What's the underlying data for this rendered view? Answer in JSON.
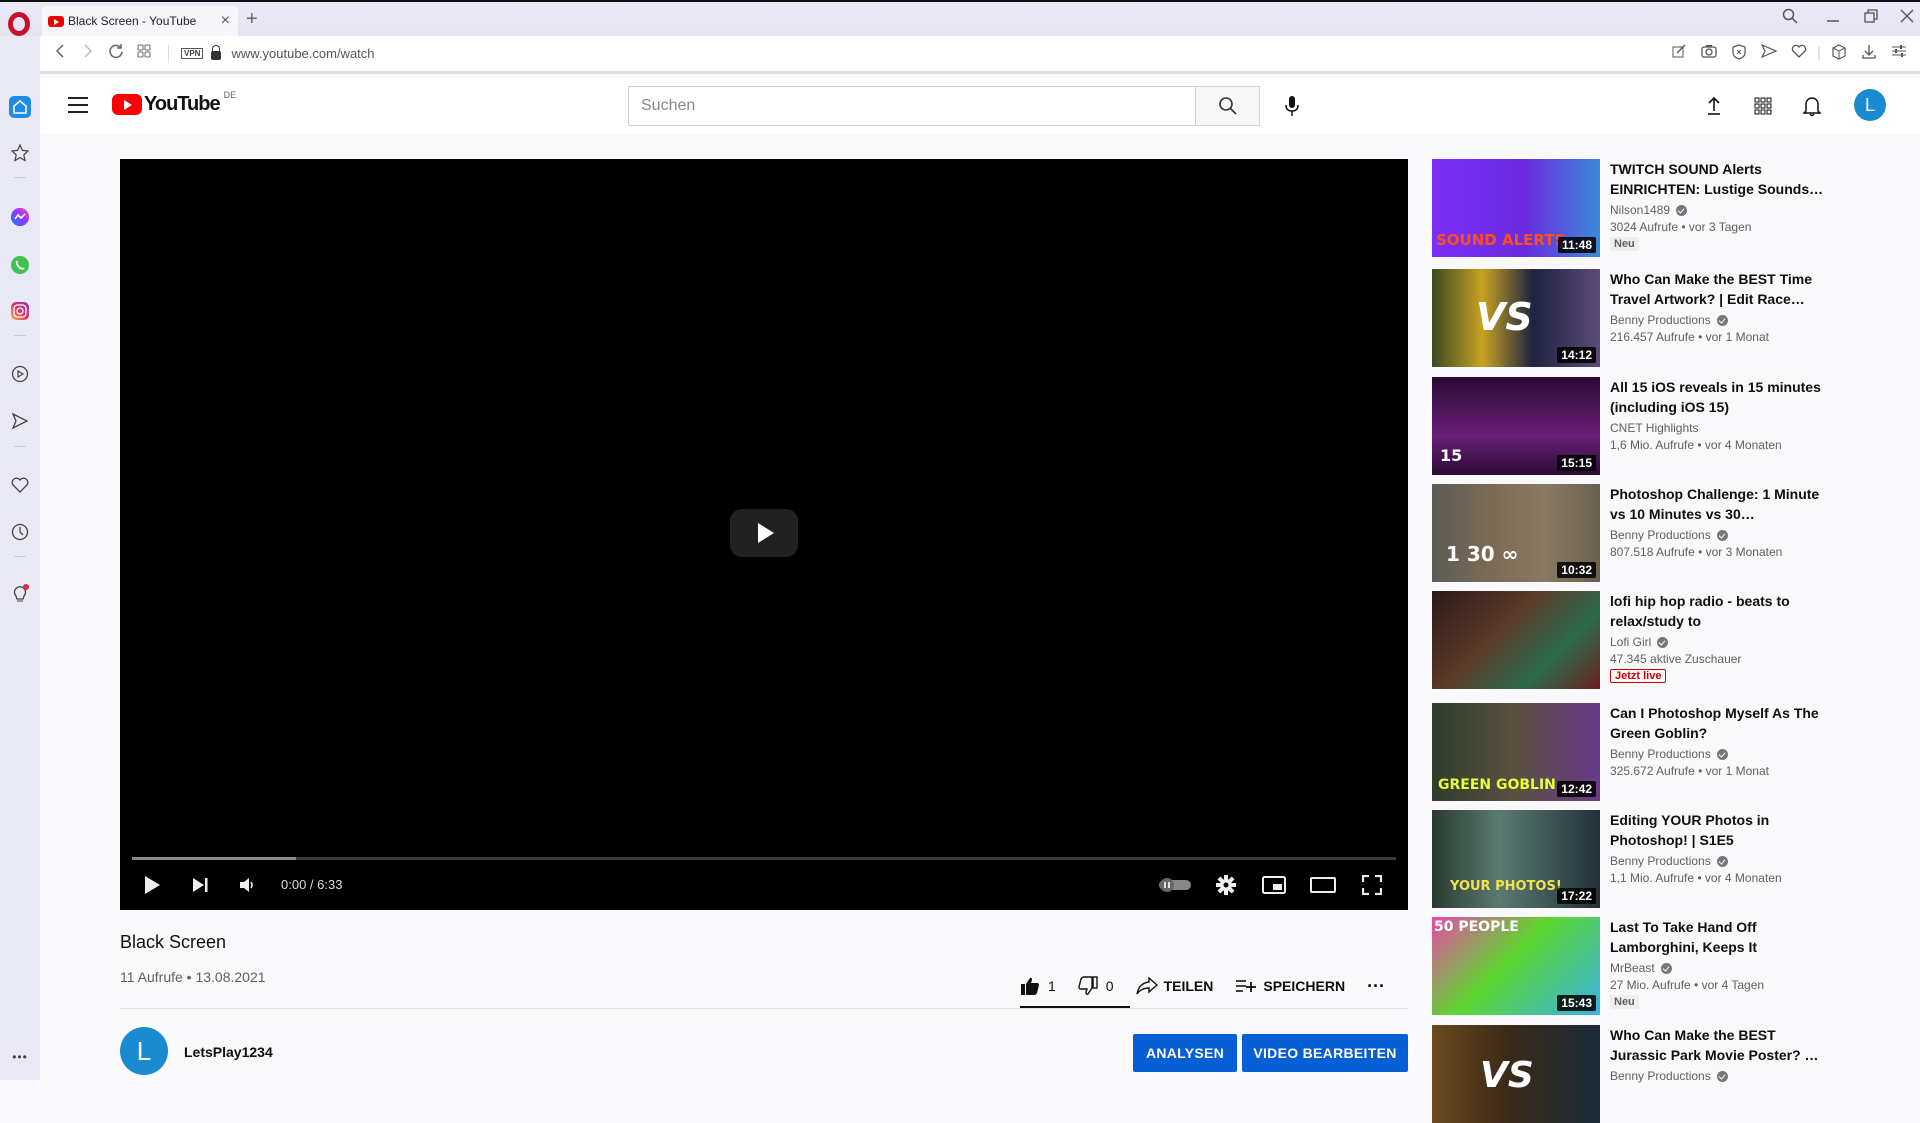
{
  "browser": {
    "tab_title": "Black Screen - YouTube",
    "new_tab_symbol": "+",
    "vpn_label": "VPN",
    "url": "www.youtube.com/watch",
    "toolbar_icons": [
      "snapshot-pin-icon",
      "camera-icon",
      "adblock-icon",
      "send-icon",
      "heart-icon",
      "extensions-cube-icon",
      "download-icon",
      "easy-setup-icon"
    ],
    "window_controls": [
      "search-tabs-icon",
      "minimize-icon",
      "restore-icon",
      "close-icon"
    ]
  },
  "opera_sidebar": {
    "items": [
      {
        "name": "home-icon",
        "active": true
      },
      {
        "name": "bookmarks-star-icon"
      },
      {
        "name": "messenger-icon"
      },
      {
        "name": "whatsapp-icon"
      },
      {
        "name": "instagram-icon"
      },
      {
        "name": "player-icon"
      },
      {
        "name": "my-flow-icon"
      },
      {
        "name": "pinboard-heart-icon"
      },
      {
        "name": "history-icon"
      },
      {
        "name": "tips-bulb-icon"
      }
    ],
    "more_label": "•••"
  },
  "youtube_header": {
    "logo_text": "YouTube",
    "country_code": "DE",
    "search_placeholder": "Suchen",
    "search_value": "",
    "avatar_letter": "L",
    "brand_color": "#ff0000",
    "avatar_color": "#1a8bd0"
  },
  "player": {
    "current_time": "0:00",
    "duration": "6:33",
    "time_display": "0:00 / 6:33",
    "buffered_fraction": 0.13,
    "played_fraction": 0,
    "autoplay_on": false
  },
  "video": {
    "title": "Black Screen",
    "meta": "11 Aufrufe • 13.08.2021",
    "views": "11 Aufrufe",
    "date": "13.08.2021",
    "likes": "1",
    "dislikes": "0",
    "share_label": "TEILEN",
    "save_label": "SPEICHERN",
    "more_label": "···",
    "channel_name": "LetsPlay1234",
    "channel_avatar_letter": "L",
    "analytics_label": "ANALYSEN",
    "edit_label": "VIDEO BEARBEITEN",
    "button_color": "#065fd4"
  },
  "recommendations": [
    {
      "title": "TWITCH SOUND Alerts EINRICHTEN: Lustige Sounds…",
      "channel": "Nilson1489",
      "verified": true,
      "stats": "3024 Aufrufe • vor 3 Tagen",
      "badge": "Neu",
      "badge_type": "new",
      "duration": "11:48",
      "thumb_text": "SOUND ALERTS"
    },
    {
      "title": "Who Can Make the BEST Time Travel Artwork? | Edit Race…",
      "channel": "Benny Productions",
      "verified": true,
      "stats": "216.457 Aufrufe • vor 1 Monat",
      "badge": "",
      "badge_type": "",
      "duration": "14:12",
      "thumb_text": "VS"
    },
    {
      "title": "All 15 iOS reveals in 15 minutes (including iOS 15)",
      "channel": "CNET Highlights",
      "verified": false,
      "stats": "1,6 Mio. Aufrufe • vor 4 Monaten",
      "badge": "",
      "badge_type": "",
      "duration": "15:15",
      "thumb_text": "15"
    },
    {
      "title": "Photoshop Challenge: 1 Minute vs 10 Minutes vs 30…",
      "channel": "Benny Productions",
      "verified": true,
      "stats": "807.518 Aufrufe • vor 3 Monaten",
      "badge": "",
      "badge_type": "",
      "duration": "10:32",
      "thumb_text": "1 30 ∞"
    },
    {
      "title": "lofi hip hop radio - beats to relax/study to",
      "channel": "Lofi Girl",
      "verified": true,
      "stats": "47.345 aktive Zuschauer",
      "badge": "Jetzt live",
      "badge_type": "live",
      "duration": "",
      "thumb_text": ""
    },
    {
      "title": "Can I Photoshop Myself As The Green Goblin?",
      "channel": "Benny Productions",
      "verified": true,
      "stats": "325.672 Aufrufe • vor 1 Monat",
      "badge": "",
      "badge_type": "",
      "duration": "12:42",
      "thumb_text": "GREEN GOBLIN"
    },
    {
      "title": "Editing YOUR Photos in Photoshop! | S1E5",
      "channel": "Benny Productions",
      "verified": true,
      "stats": "1,1 Mio. Aufrufe • vor 4 Monaten",
      "badge": "",
      "badge_type": "",
      "duration": "17:22",
      "thumb_text": "YOUR PHOTOS!"
    },
    {
      "title": "Last To Take Hand Off Lamborghini, Keeps It",
      "channel": "MrBeast",
      "verified": true,
      "stats": "27 Mio. Aufrufe • vor 4 Tagen",
      "badge": "Neu",
      "badge_type": "new",
      "duration": "15:43",
      "thumb_text": "50 PEOPLE"
    },
    {
      "title": "Who Can Make the BEST Jurassic Park Movie Poster? …",
      "channel": "Benny Productions",
      "verified": true,
      "stats": "",
      "badge": "",
      "badge_type": "",
      "duration": "",
      "thumb_text": "VS"
    }
  ]
}
